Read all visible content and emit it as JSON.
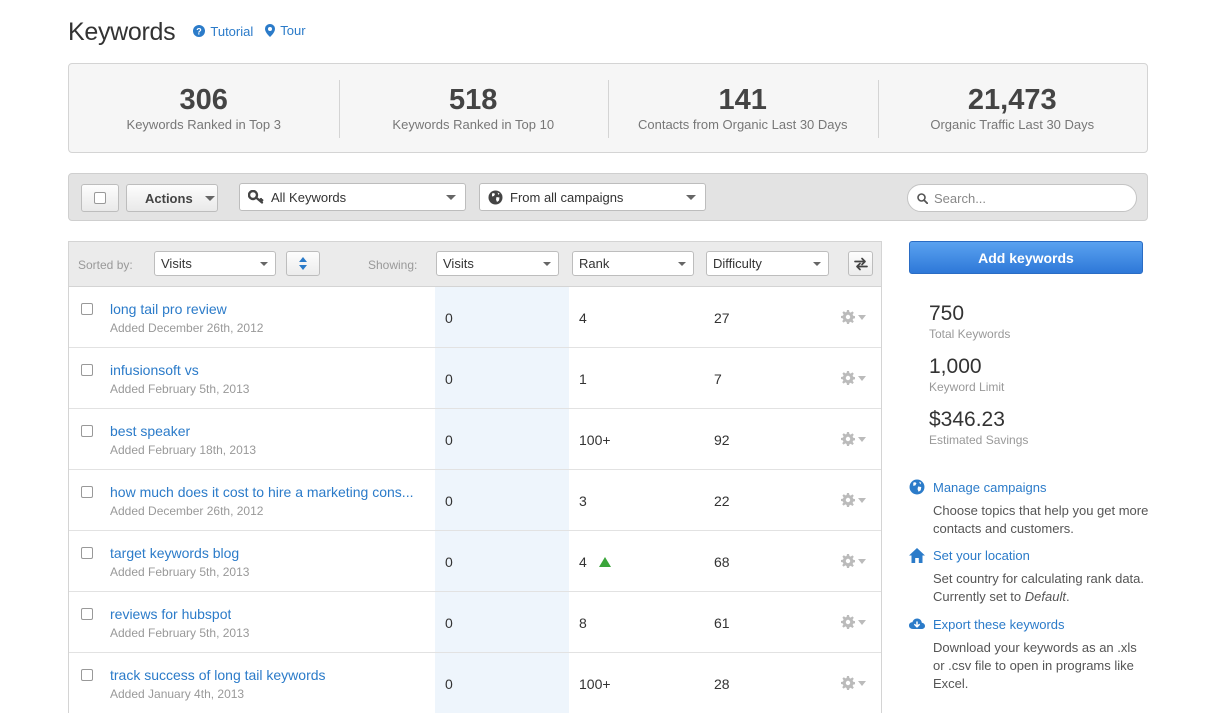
{
  "header": {
    "title": "Keywords",
    "tutorial_label": "Tutorial",
    "tour_label": "Tour"
  },
  "stats": [
    {
      "value": "306",
      "label": "Keywords Ranked in Top 3"
    },
    {
      "value": "518",
      "label": "Keywords Ranked in Top 10"
    },
    {
      "value": "141",
      "label": "Contacts from Organic Last 30 Days"
    },
    {
      "value": "21,473",
      "label": "Organic Traffic Last 30 Days"
    }
  ],
  "toolbar": {
    "actions_label": "Actions",
    "keyword_filter": "All Keywords",
    "campaign_filter": "From all campaigns",
    "search_placeholder": "Search..."
  },
  "table_header": {
    "sorted_by_label": "Sorted by:",
    "sorted_by_value": "Visits",
    "showing_label": "Showing:",
    "col1": "Visits",
    "col2": "Rank",
    "col3": "Difficulty"
  },
  "rows": [
    {
      "keyword": "long tail pro review",
      "added": "Added December 26th, 2012",
      "visits": "0",
      "rank": "4",
      "difficulty": "27",
      "trend_up": false
    },
    {
      "keyword": "infusionsoft vs",
      "added": "Added February 5th, 2013",
      "visits": "0",
      "rank": "1",
      "difficulty": "7",
      "trend_up": false
    },
    {
      "keyword": "best speaker",
      "added": "Added February 18th, 2013",
      "visits": "0",
      "rank": "100+",
      "difficulty": "92",
      "trend_up": false
    },
    {
      "keyword": "how much does it cost to hire a marketing cons...",
      "added": "Added December 26th, 2012",
      "visits": "0",
      "rank": "3",
      "difficulty": "22",
      "trend_up": false
    },
    {
      "keyword": "target keywords blog",
      "added": "Added February 5th, 2013",
      "visits": "0",
      "rank": "4",
      "difficulty": "68",
      "trend_up": true
    },
    {
      "keyword": "reviews for hubspot",
      "added": "Added February 5th, 2013",
      "visits": "0",
      "rank": "8",
      "difficulty": "61",
      "trend_up": false
    },
    {
      "keyword": "track success of long tail keywords",
      "added": "Added January 4th, 2013",
      "visits": "0",
      "rank": "100+",
      "difficulty": "28",
      "trend_up": false
    }
  ],
  "sidebar": {
    "add_button": "Add keywords",
    "summary": [
      {
        "value": "750",
        "label": "Total Keywords"
      },
      {
        "value": "1,000",
        "label": "Keyword Limit"
      },
      {
        "value": "$346.23",
        "label": "Estimated Savings"
      }
    ],
    "links": [
      {
        "label": "Manage campaigns",
        "desc": "Choose topics that help you get more contacts and customers."
      },
      {
        "label": "Set your location",
        "desc_prefix": "Set country for calculating rank data. Currently set to ",
        "desc_em": "Default",
        "desc_suffix": "."
      },
      {
        "label": "Export these keywords",
        "desc": "Download your keywords as an .xls or .csv file to open in programs like Excel."
      }
    ]
  },
  "colors": {
    "link": "#2b7bc9",
    "primary_button": "#2e78d8",
    "trend_up": "#3ba53b",
    "visits_column_bg": "#eef5fc"
  },
  "icons": {
    "tutorial": "question-circle-icon",
    "tour": "map-pin-icon",
    "keywords_filter": "key-icon",
    "campaigns_filter": "globe-icon",
    "search": "search-icon",
    "sort_direction": "sort-arrows-icon",
    "swap_columns": "swap-arrows-icon",
    "row_settings": "gear-icon",
    "manage_campaigns": "globe-icon",
    "set_location": "home-icon",
    "export": "cloud-download-icon"
  }
}
